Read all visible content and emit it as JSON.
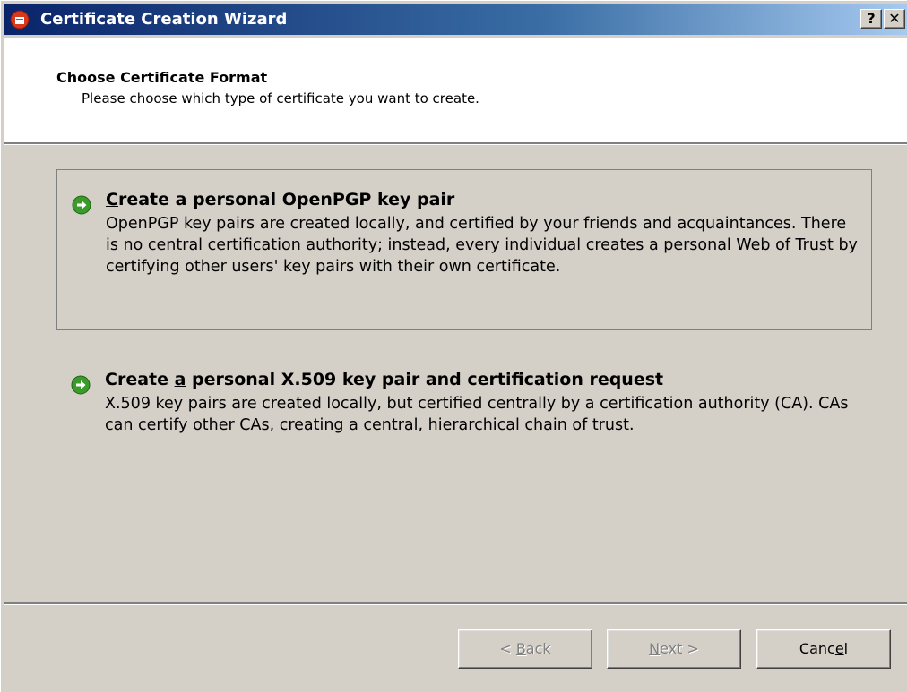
{
  "window": {
    "title": "Certificate Creation Wizard",
    "help_button": "?",
    "close_button": "✕"
  },
  "header": {
    "title": "Choose Certificate Format",
    "subtitle": "Please choose which type of certificate you want to create."
  },
  "options": [
    {
      "title_mnemonic": "C",
      "title_rest": "reate a personal OpenPGP key pair",
      "description": "OpenPGP key pairs are created locally, and certified by your friends and acquaintances. There is no central certification authority; instead, every individual creates a personal Web of Trust by certifying other users' key pairs with their own certificate.",
      "icon": "green-arrow-icon",
      "focused": true
    },
    {
      "title_pre": "Create ",
      "title_mnemonic": "a",
      "title_rest": " personal X.509 key pair and certification request",
      "description": "X.509 key pairs are created locally, but certified centrally by a certification authority (CA). CAs can certify other CAs, creating a central, hierarchical chain of trust.",
      "icon": "green-arrow-icon",
      "focused": false
    }
  ],
  "buttons": {
    "back_pre": "< ",
    "back_mnemonic": "B",
    "back_rest": "ack",
    "next_mnemonic": "N",
    "next_rest": "ext >",
    "cancel_pre": "Canc",
    "cancel_mnemonic": "e",
    "cancel_rest": "l"
  },
  "colors": {
    "titlebar_start": "#0a246a",
    "titlebar_end": "#a6caf0",
    "dialog_bg": "#d4d0c8",
    "arrow_green": "#3a9a2a"
  }
}
